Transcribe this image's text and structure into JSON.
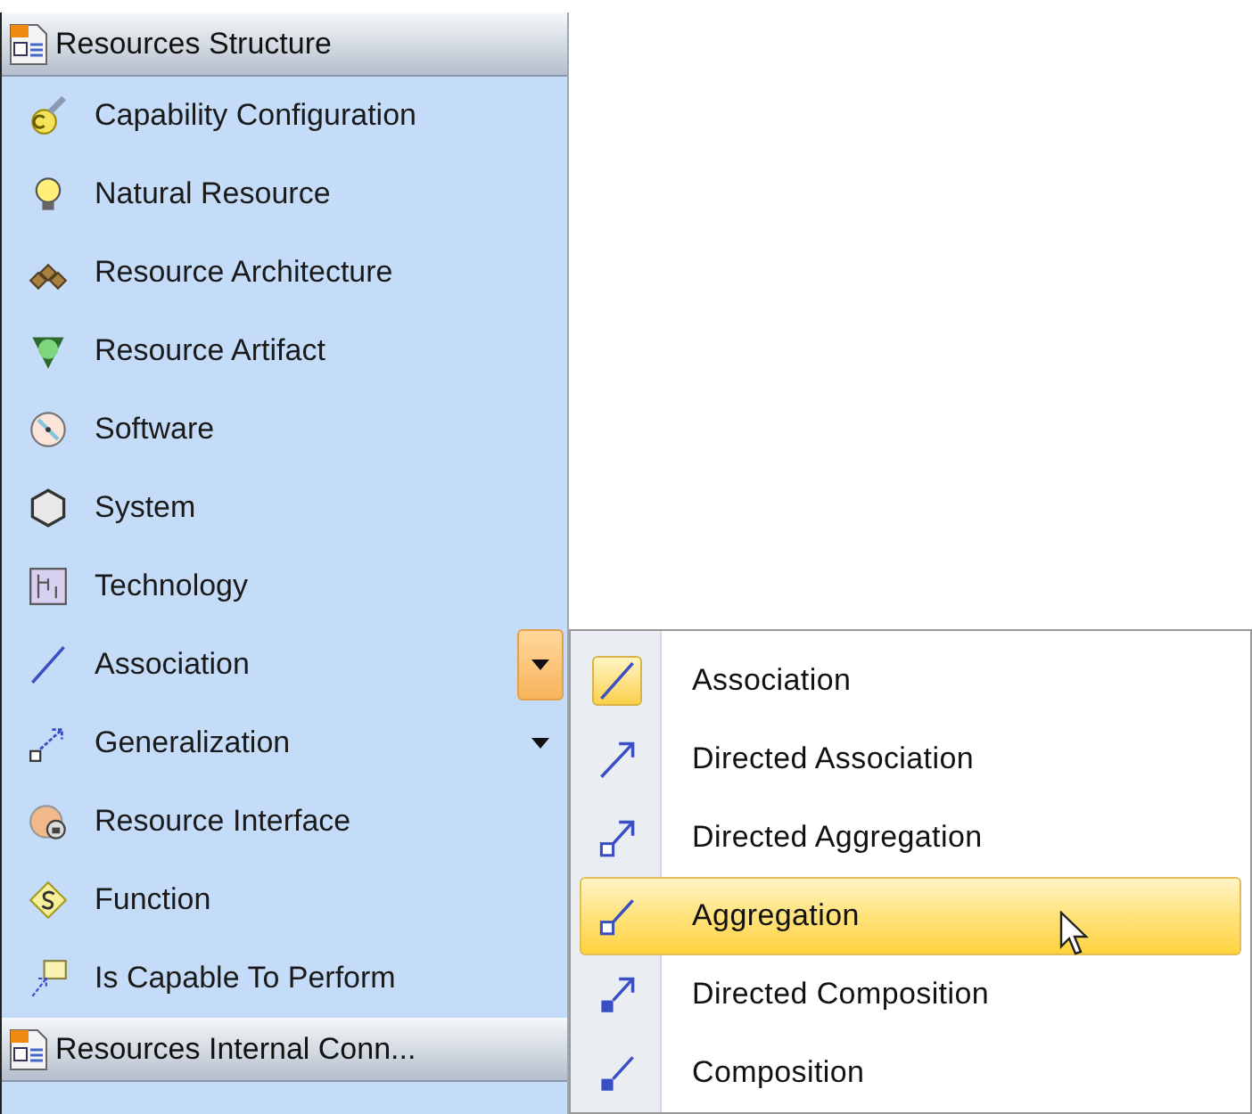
{
  "palette": {
    "groups": [
      {
        "title": "Resources Structure",
        "items": [
          {
            "label": "Capability Configuration",
            "kind": "capability",
            "dropdown": false
          },
          {
            "label": "Natural Resource",
            "kind": "bulb",
            "dropdown": false
          },
          {
            "label": "Resource Architecture",
            "kind": "architecture",
            "dropdown": false
          },
          {
            "label": "Resource Artifact",
            "kind": "artifact",
            "dropdown": false
          },
          {
            "label": "Software",
            "kind": "software",
            "dropdown": false
          },
          {
            "label": "System",
            "kind": "system",
            "dropdown": false
          },
          {
            "label": "Technology",
            "kind": "technology",
            "dropdown": false
          },
          {
            "label": "Association",
            "kind": "line",
            "dropdown": true,
            "expanded": true
          },
          {
            "label": "Generalization",
            "kind": "generalization",
            "dropdown": true,
            "expanded": false
          },
          {
            "label": "Resource Interface",
            "kind": "interface",
            "dropdown": false
          },
          {
            "label": "Function",
            "kind": "function",
            "dropdown": false
          },
          {
            "label": "Is Capable To Perform",
            "kind": "capable",
            "dropdown": false
          }
        ]
      },
      {
        "title": "Resources Internal Conn..."
      }
    ]
  },
  "menu": {
    "items": [
      {
        "label": "Association",
        "kind": "line",
        "checked": true,
        "selected": false
      },
      {
        "label": "Directed Association",
        "kind": "arrow",
        "checked": false,
        "selected": false
      },
      {
        "label": "Directed Aggregation",
        "kind": "hollow-arrow",
        "checked": false,
        "selected": false
      },
      {
        "label": "Aggregation",
        "kind": "hollow",
        "checked": false,
        "selected": true
      },
      {
        "label": "Directed Composition",
        "kind": "filled-arrow",
        "checked": false,
        "selected": false
      },
      {
        "label": "Composition",
        "kind": "filled",
        "checked": false,
        "selected": false
      }
    ]
  }
}
